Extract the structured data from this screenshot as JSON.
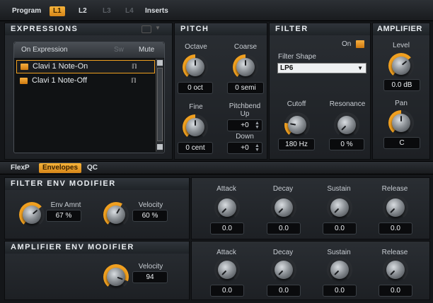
{
  "topbar": {
    "tabs": [
      "Program",
      "L1",
      "L2",
      "L3",
      "L4",
      "Inserts"
    ]
  },
  "expressions": {
    "title": "EXPRESSIONS",
    "header_label": "On Expression",
    "header_sw": "Sw",
    "header_mute": "Mute",
    "rows": [
      "Clavi 1 Note-On",
      "Clavi 1 Note-Off"
    ]
  },
  "pitch": {
    "title": "PITCH",
    "octave_label": "Octave",
    "octave_value": "0 oct",
    "coarse_label": "Coarse",
    "coarse_value": "0 semi",
    "fine_label": "Fine",
    "fine_value": "0 cent",
    "pitchbend_label": "Pitchbend",
    "up_label": "Up",
    "up_value": "+0",
    "down_label": "Down",
    "down_value": "+0"
  },
  "filter": {
    "title": "FILTER",
    "on_label": "On",
    "shape_label": "Filter Shape",
    "shape_value": "LP6",
    "cutoff_label": "Cutoff",
    "cutoff_value": "180 Hz",
    "resonance_label": "Resonance",
    "resonance_value": "0 %"
  },
  "amplifier": {
    "title": "AMPLIFIER",
    "level_label": "Level",
    "level_value": "0.0 dB",
    "pan_label": "Pan",
    "pan_value": "C"
  },
  "subtabs": [
    "FlexP",
    "Envelopes",
    "QC"
  ],
  "filter_env": {
    "title": "FILTER ENV MODIFIER",
    "env_amnt_label": "Env Amnt",
    "env_amnt_value": "67 %",
    "velocity_label": "Velocity",
    "velocity_value": "60 %",
    "attack_label": "Attack",
    "attack_value": "0.0",
    "decay_label": "Decay",
    "decay_value": "0.0",
    "sustain_label": "Sustain",
    "sustain_value": "0.0",
    "release_label": "Release",
    "release_value": "0.0"
  },
  "amp_env": {
    "title": "AMPLIFIER ENV MODIFIER",
    "velocity_label": "Velocity",
    "velocity_value": "94",
    "attack_label": "Attack",
    "attack_value": "0.0",
    "decay_label": "Decay",
    "decay_value": "0.0",
    "sustain_label": "Sustain",
    "sustain_value": "0.0",
    "release_label": "Release",
    "release_value": "0.0"
  },
  "colors": {
    "accent": "#f0a020",
    "background": "#141619"
  }
}
